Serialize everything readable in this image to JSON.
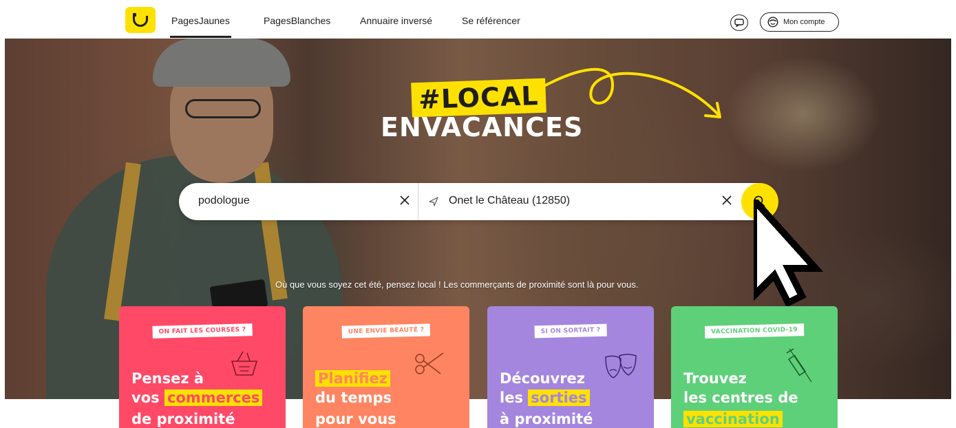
{
  "header": {
    "logo_alt": "PagesJaunes logo",
    "nav": [
      {
        "label": "PagesJaunes",
        "active": true
      },
      {
        "label": "PagesBlanches",
        "active": false
      },
      {
        "label": "Annuaire inversé",
        "active": false
      },
      {
        "label": "Se référencer",
        "active": false
      }
    ],
    "account_label": "Mon compte",
    "chat_icon": "chat-bubble-icon",
    "account_icon": "user-face-icon"
  },
  "hero": {
    "hashtag": "#LOCAL",
    "tagline": "ENVACANCES",
    "subtitle": "Où que vous soyez cet été, pensez local ! Les commerçants de proximité sont là pour vous."
  },
  "search": {
    "what_value": "podologue",
    "where_value": "Onet le Château (12850)",
    "search_icon": "search-icon",
    "clear_icon": "close-icon",
    "location_icon": "location-arrow-icon"
  },
  "cards": [
    {
      "badge": "ON FAIT LES COURSES ?",
      "line1_pre": "Pensez à",
      "line2_pre": "vos",
      "line2_hl": "commerces",
      "line3": "de proximité",
      "icon": "shopping-basket-icon",
      "color": "#ff4966"
    },
    {
      "badge": "UNE ENVIE BEAUTÉ ?",
      "line1_hl": "Planifiez",
      "line2": "du temps",
      "line3": "pour vous",
      "icon": "scissors-icon",
      "color": "#ff8562"
    },
    {
      "badge": "SI ON SORTAIT ?",
      "line1": "Découvrez",
      "line2_pre": "les",
      "line2_hl": "sorties",
      "line3": "à proximité",
      "icon": "theater-masks-icon",
      "color": "#a486df"
    },
    {
      "badge": "VACCINATION COVID-19",
      "line1": "Trouvez",
      "line2": "les centres de",
      "line3_hl": "vaccination",
      "icon": "syringe-icon",
      "color": "#5fd07a"
    }
  ],
  "colors": {
    "brand_yellow": "#ffe100",
    "text": "#1e1e1e"
  }
}
